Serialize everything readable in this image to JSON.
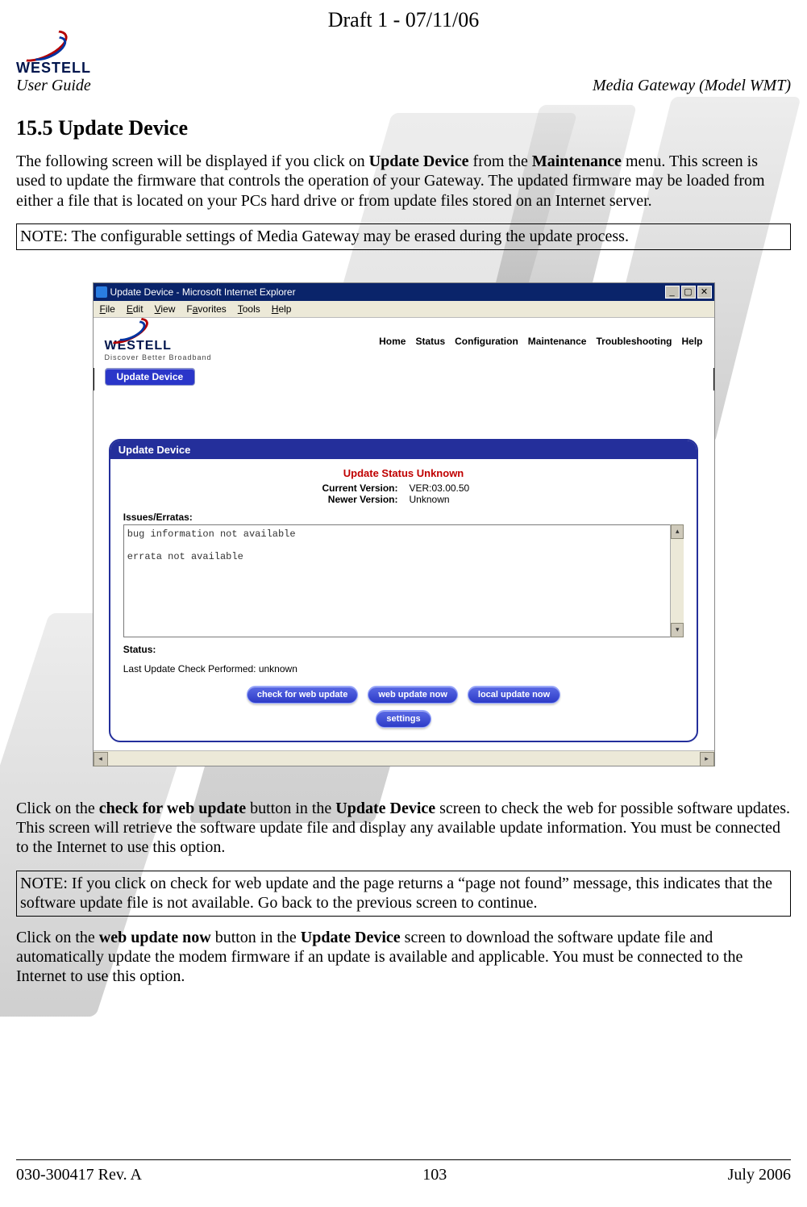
{
  "draft_header": "Draft 1 - 07/11/06",
  "logo_text": "WESTELL",
  "user_guide": "User Guide",
  "model": "Media Gateway (Model WMT)",
  "section_title": "15.5 Update Device",
  "para1_pre": "The following screen will be displayed if you click on ",
  "para1_b1": "Update Device",
  "para1_mid": " from the ",
  "para1_b2": "Maintenance",
  "para1_post": " menu. This screen is used to update the firmware that controls the operation of your Gateway. The updated firmware may be loaded from either a file that is located on your PCs hard drive or from update files stored on an Internet server.",
  "note1": "NOTE: The configurable settings of Media Gateway may be erased during the update process.",
  "shot": {
    "window_title": "Update Device - Microsoft Internet Explorer",
    "min": "_",
    "max": "▢",
    "close": "✕",
    "menu": {
      "file": "File",
      "edit": "Edit",
      "view": "View",
      "fav": "Favorites",
      "tools": "Tools",
      "help": "Help"
    },
    "app_logo": "WESTELL",
    "app_tag": "Discover Better Broadband",
    "nav": {
      "home": "Home",
      "status": "Status",
      "config": "Configuration",
      "maint": "Maintenance",
      "trouble": "Troubleshooting",
      "help": "Help"
    },
    "selected_button": "Update Device",
    "panel_title": "Update Device",
    "status_unknown": "Update Status Unknown",
    "cur_label": "Current Version:",
    "cur_val": "VER:03.00.50",
    "new_label": "Newer Version:",
    "new_val": "Unknown",
    "issues_label": "Issues/Erratas:",
    "errata_text": "bug information not available\n\nerrata not available",
    "status_label": "Status:",
    "status_text": "Last Update Check Performed: unknown",
    "btn_check": "check for web update",
    "btn_webnow": "web update now",
    "btn_local": "local update now",
    "btn_settings": "settings"
  },
  "para2_pre": "Click on the ",
  "para2_b1": "check for web update",
  "para2_mid1": " button in the ",
  "para2_b2": "Update Device",
  "para2_post": " screen to check the web for possible software updates. This screen will retrieve the software update file and display any available update information. You must be connected to the Internet to use this option.",
  "note2": "NOTE: If you click on check for web update and the page returns a “page not found” message, this indicates that the software update file is not available. Go back to the previous screen to continue.",
  "para3_pre": "Click on the ",
  "para3_b1": "web update now",
  "para3_mid1": " button in the ",
  "para3_b2": "Update Device",
  "para3_post": " screen to download the software update file and automatically update the modem firmware if an update is available and applicable. You must be connected to the Internet to use this option.",
  "footer": {
    "doc": "030-300417 Rev. A",
    "page": "103",
    "date": "July 2006"
  }
}
